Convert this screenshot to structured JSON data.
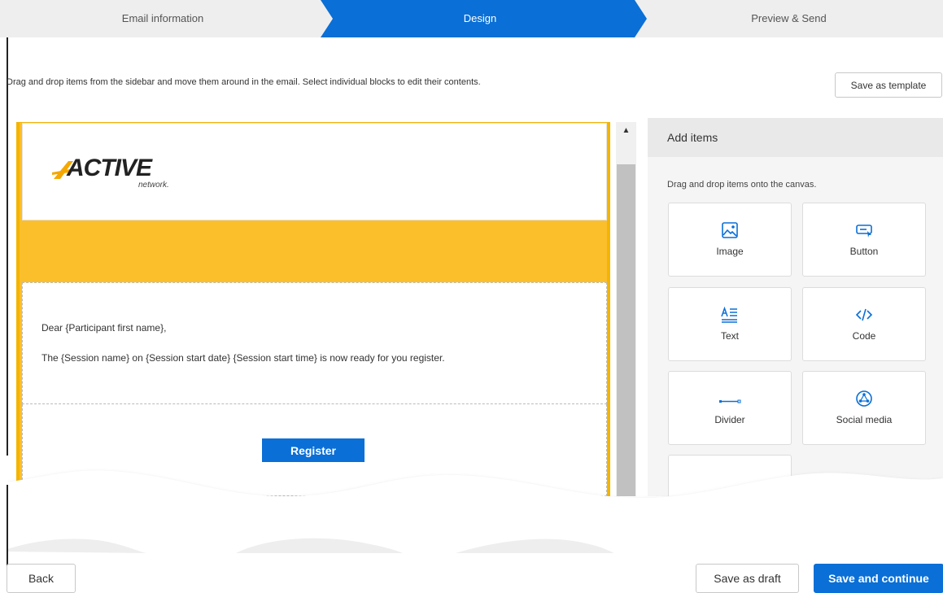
{
  "stepper": {
    "steps": [
      {
        "label": "Email information",
        "state": "done"
      },
      {
        "label": "Design",
        "state": "active"
      },
      {
        "label": "Preview & Send",
        "state": "upcoming"
      }
    ],
    "active_color": "#0a6fd6"
  },
  "toolbar": {
    "instructions": "Drag and drop items from the sidebar and move them around in the email. Select individual blocks to edit their contents.",
    "save_template_label": "Save as template"
  },
  "email": {
    "logo_text": "ACTIVE",
    "logo_subtext": "network.",
    "greeting": "Dear {Participant first name},",
    "body": "The {Session name} on {Session start date} {Session start time} is now ready for you register.",
    "button_label": "Register",
    "band_color": "#fbbf2c"
  },
  "sidebar": {
    "title": "Add items",
    "hint": "Drag and drop items onto the canvas.",
    "items": [
      {
        "label": "Image",
        "icon": "image-icon"
      },
      {
        "label": "Button",
        "icon": "button-icon"
      },
      {
        "label": "Text",
        "icon": "text-icon"
      },
      {
        "label": "Code",
        "icon": "code-icon"
      },
      {
        "label": "Divider",
        "icon": "divider-icon"
      },
      {
        "label": "Social media",
        "icon": "social-media-icon"
      }
    ]
  },
  "footer": {
    "back_label": "Back",
    "draft_label": "Save as draft",
    "continue_label": "Save and continue"
  }
}
